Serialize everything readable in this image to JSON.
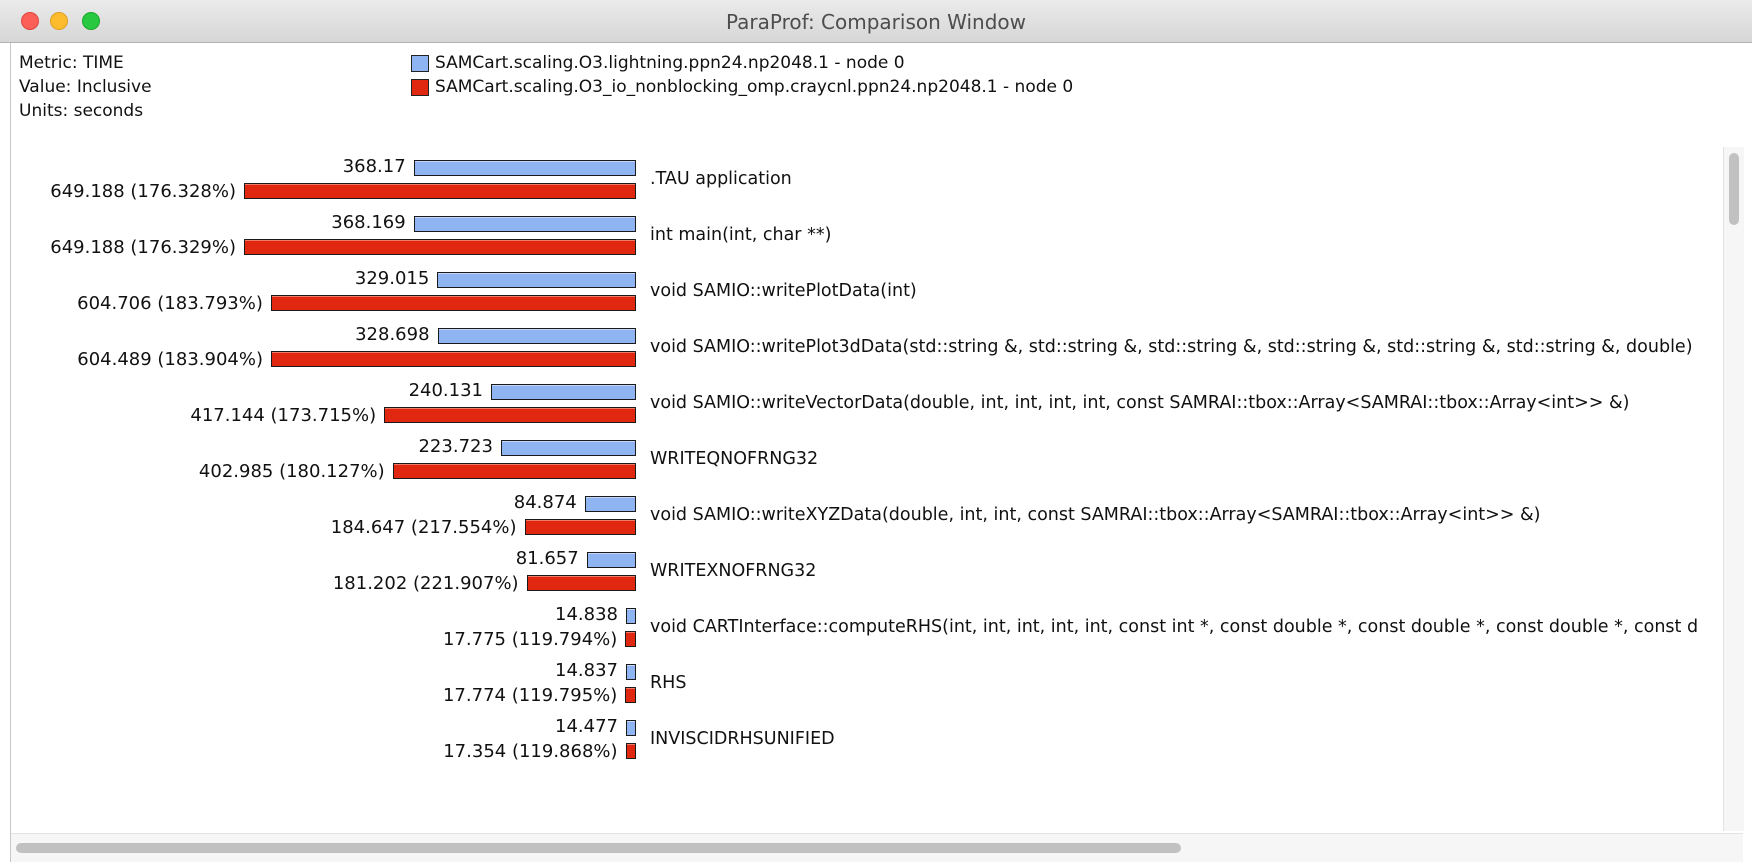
{
  "window": {
    "title": "ParaProf: Comparison Window"
  },
  "meta": {
    "metric": "Metric: TIME",
    "value": "Value: Inclusive",
    "units": "Units: seconds"
  },
  "legend": {
    "series": [
      {
        "name": "SAMCart.scaling.O3.lightning.ppn24.np2048.1 - node 0",
        "color": "#8fb4f2"
      },
      {
        "name": "SAMCart.scaling.O3_io_nonblocking_omp.craycnl.ppn24.np2048.1 - node 0",
        "color": "#e02810"
      }
    ]
  },
  "chart_data": {
    "type": "bar",
    "orientation": "horizontal",
    "metric": "TIME",
    "value_type": "Inclusive",
    "units": "seconds",
    "categories": [
      ".TAU application",
      "int main(int, char **)",
      "void SAMIO::writePlotData(int)",
      "void SAMIO::writePlot3dData(std::string &, std::string &, std::string &, std::string &, std::string &, std::string &, double)",
      "void SAMIO::writeVectorData(double, int, int, int, int, const SAMRAI::tbox::Array<SAMRAI::tbox::Array<int>> &)",
      "WRITEQNOFRNG32",
      "void SAMIO::writeXYZData(double, int, int, const SAMRAI::tbox::Array<SAMRAI::tbox::Array<int>> &)",
      "WRITEXNOFRNG32",
      "void CARTInterface::computeRHS(int, int, int, int, int, const int *, const double *, const double *, const double *, const d",
      "RHS",
      "INVISCIDRHSUNIFIED"
    ],
    "series": [
      {
        "name": "SAMCart.scaling.O3.lightning.ppn24.np2048.1 - node 0",
        "color": "#8fb4f2",
        "values": [
          368.17,
          368.169,
          329.015,
          328.698,
          240.131,
          223.723,
          84.874,
          81.657,
          14.838,
          14.837,
          14.477
        ],
        "labels": [
          "368.17",
          "368.169",
          "329.015",
          "328.698",
          "240.131",
          "223.723",
          "84.874",
          "81.657",
          "14.838",
          "14.837",
          "14.477"
        ]
      },
      {
        "name": "SAMCart.scaling.O3_io_nonblocking_omp.craycnl.ppn24.np2048.1 - node 0",
        "color": "#e02810",
        "values": [
          649.188,
          649.188,
          604.706,
          604.489,
          417.144,
          402.985,
          184.647,
          181.202,
          17.775,
          17.774,
          17.354
        ],
        "labels": [
          "649.188 (176.328%)",
          "649.188 (176.329%)",
          "604.706 (183.793%)",
          "604.489 (183.904%)",
          "417.144 (173.715%)",
          "402.985 (180.127%)",
          "184.647 (217.554%)",
          "181.202 (221.907%)",
          "17.775 (119.794%)",
          "17.774 (119.795%)",
          "17.354 (119.868%)"
        ]
      }
    ]
  }
}
